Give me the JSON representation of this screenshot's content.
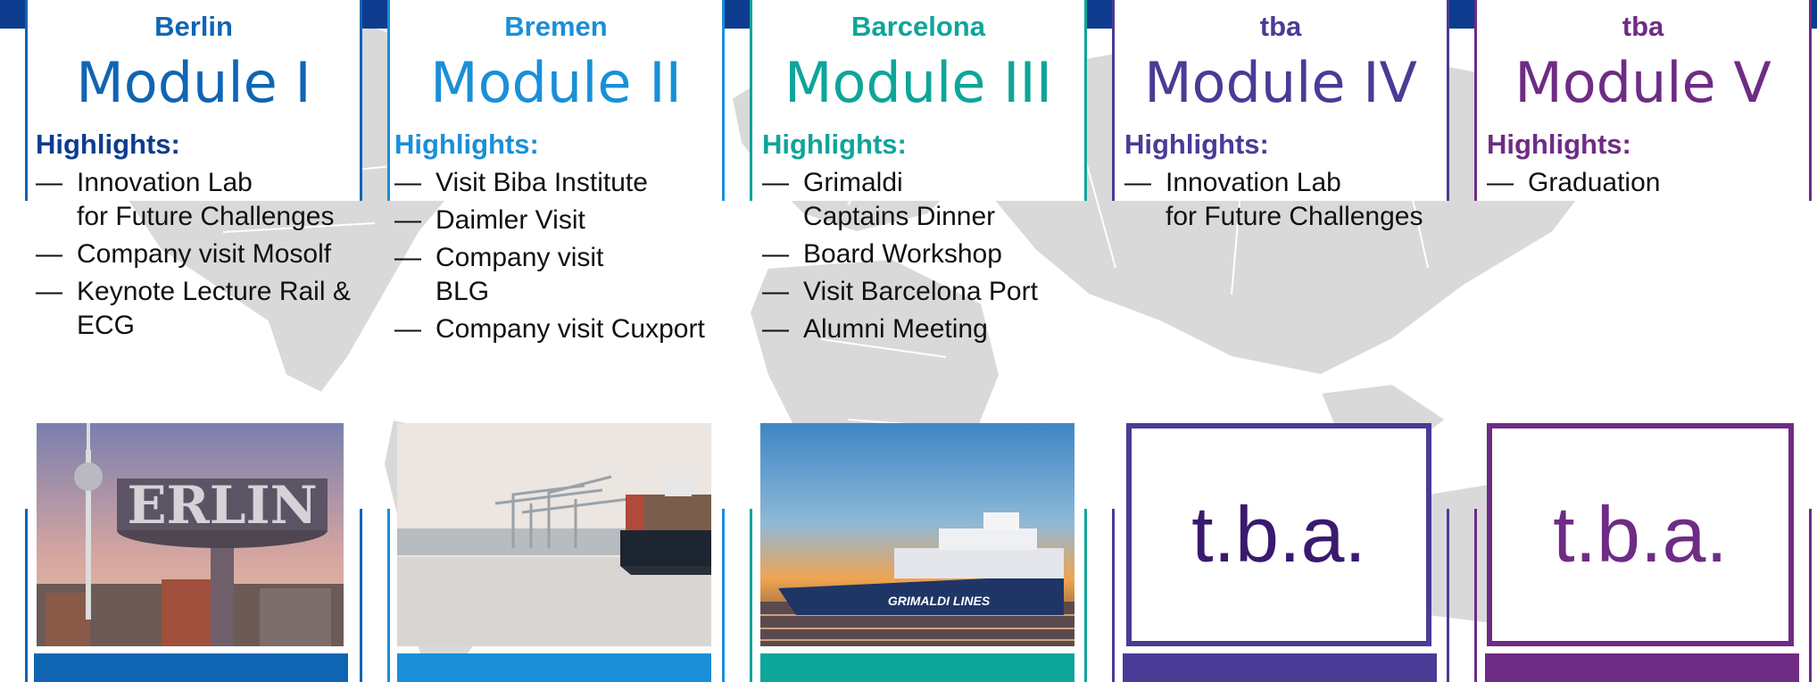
{
  "colors": {
    "topbar": "#0d3c8f",
    "map": "#d9d9d9"
  },
  "modules": [
    {
      "city": "Berlin",
      "title": "Module I",
      "color": "#1065b3",
      "highlights_label": "Highlights:",
      "label_color": "#0d3c8f",
      "highlights": [
        "Innovation Lab\nfor Future Challenges",
        "Company visit Mosolf",
        "Keynote Lecture Rail &\nECG"
      ],
      "image": "berlin-tower-photo"
    },
    {
      "city": "Bremen",
      "title": "Module II",
      "color": "#1a8fd8",
      "highlights_label": "Highlights:",
      "label_color": "#1a8fd8",
      "highlights": [
        "Visit Biba Institute",
        "Daimler Visit",
        "Company visit\nBLG",
        "Company visit Cuxport"
      ],
      "image": "bremen-port-photo"
    },
    {
      "city": "Barcelona",
      "title": "Module III",
      "color": "#0ea59a",
      "highlights_label": "Highlights:",
      "label_color": "#0ea59a",
      "highlights": [
        "Grimaldi\nCaptains Dinner",
        "Board Workshop",
        "Visit Barcelona Port",
        "Alumni Meeting"
      ],
      "image": "grimaldi-ship-photo",
      "ship_text": "GRIMALDI LINES"
    },
    {
      "city": "tba",
      "title": "Module IV",
      "color": "#4a3b96",
      "highlights_label": "Highlights:",
      "label_color": "#4a3b96",
      "highlights": [
        "Innovation Lab\nfor Future Challenges"
      ],
      "placeholder": "t.b.a.",
      "placeholder_color": "#3a1a6e"
    },
    {
      "city": "tba",
      "title": "Module V",
      "color": "#6e2c85",
      "highlights_label": "Highlights:",
      "label_color": "#6e2c85",
      "highlights": [
        "Graduation"
      ],
      "placeholder": "t.b.a.",
      "placeholder_color": "#6e2c85"
    }
  ]
}
